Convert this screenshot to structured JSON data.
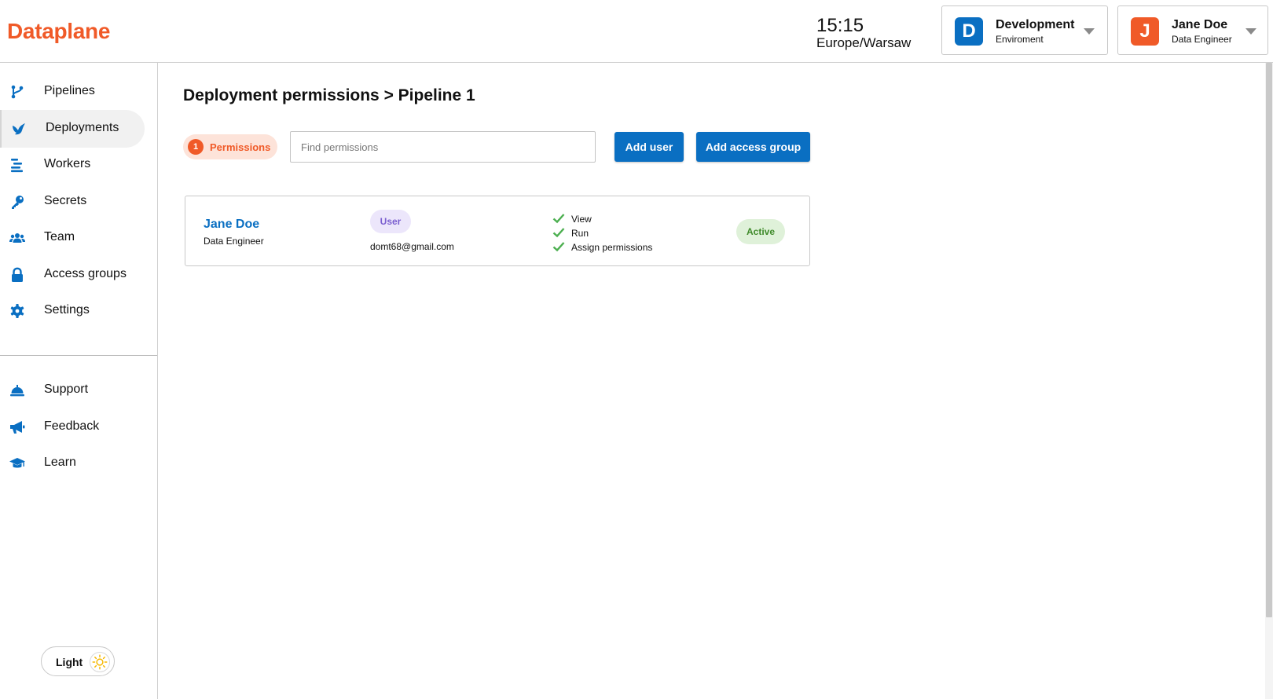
{
  "app": {
    "name": "Dataplane"
  },
  "clock": {
    "time": "15:15",
    "timezone": "Europe/Warsaw"
  },
  "environment": {
    "initial": "D",
    "name": "Development",
    "subtitle": "Enviroment",
    "color": "#0a6fc2"
  },
  "user": {
    "initial": "J",
    "name": "Jane Doe",
    "role": "Data Engineer",
    "color": "#f05a28"
  },
  "sidebar": {
    "items": [
      {
        "label": "Pipelines",
        "icon": "pipeline-branch-icon",
        "active": false
      },
      {
        "label": "Deployments",
        "icon": "deployment-bird-icon",
        "active": true
      },
      {
        "label": "Workers",
        "icon": "workers-lines-icon",
        "active": false
      },
      {
        "label": "Secrets",
        "icon": "key-icon",
        "active": false
      },
      {
        "label": "Team",
        "icon": "team-people-icon",
        "active": false
      },
      {
        "label": "Access groups",
        "icon": "lock-icon",
        "active": false
      },
      {
        "label": "Settings",
        "icon": "gear-icon",
        "active": false
      }
    ],
    "bottom_items": [
      {
        "label": "Support",
        "icon": "bell-service-icon"
      },
      {
        "label": "Feedback",
        "icon": "megaphone-icon"
      },
      {
        "label": "Learn",
        "icon": "graduation-cap-icon"
      }
    ],
    "theme_toggle": {
      "label": "Light",
      "icon": "sun-icon"
    }
  },
  "main": {
    "title": "Deployment permissions > Pipeline 1",
    "permissions_pill": {
      "count": "1",
      "label": "Permissions"
    },
    "search": {
      "placeholder": "Find permissions",
      "value": ""
    },
    "buttons": {
      "add_user": "Add user",
      "add_access_group": "Add access group"
    },
    "permissions": [
      {
        "name": "Jane Doe",
        "role": "Data Engineer",
        "type": "User",
        "email": "domt68@gmail.com",
        "rights": [
          "View",
          "Run",
          "Assign permissions"
        ],
        "status": "Active"
      }
    ]
  },
  "colors": {
    "brand": "#f05a28",
    "primary": "#0a6fc2",
    "check": "#4caf50",
    "status_bg": "#dff1d9",
    "status_text": "#3f8a2a",
    "type_badge_bg": "#ece6fb",
    "type_badge_text": "#7b5fd0"
  }
}
